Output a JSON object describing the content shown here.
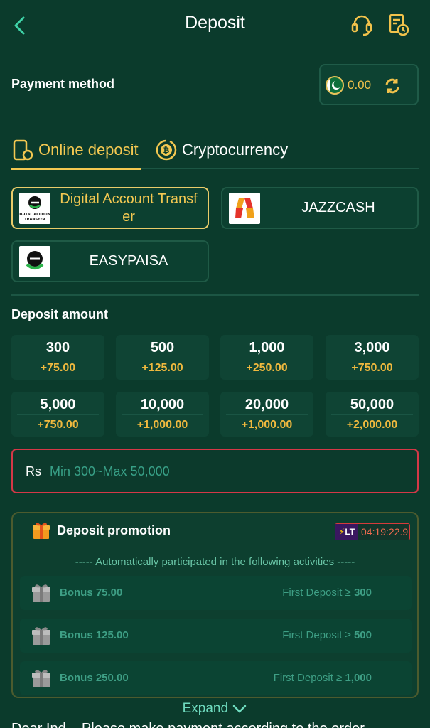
{
  "header": {
    "title": "Deposit",
    "back_icon": "chevron-left-icon",
    "support_icon": "headset-icon",
    "records_icon": "records-clock-icon"
  },
  "payment_method": {
    "label": "Payment method",
    "balance": "0.00",
    "currency_icon": "pakistan-flag-icon",
    "refresh_icon": "refresh-icon"
  },
  "tabs": [
    {
      "label": "Online deposit",
      "icon": "phone-icon",
      "active": true
    },
    {
      "label": "Cryptocurrency",
      "icon": "bitcoin-icon",
      "active": false
    }
  ],
  "methods": [
    {
      "label": "Digital Account Transf er",
      "logo_text": "DIGITAL ACCOUNT TRANSFER",
      "selected": true
    },
    {
      "label": "JAZZCASH",
      "selected": false
    },
    {
      "label": "EASYPAISA",
      "selected": false
    }
  ],
  "deposit_amount": {
    "label": "Deposit amount",
    "options": [
      {
        "amount": "300",
        "bonus": "+75.00"
      },
      {
        "amount": "500",
        "bonus": "+125.00"
      },
      {
        "amount": "1,000",
        "bonus": "+250.00"
      },
      {
        "amount": "3,000",
        "bonus": "+750.00"
      },
      {
        "amount": "5,000",
        "bonus": "+750.00"
      },
      {
        "amount": "10,000",
        "bonus": "+1,000.00"
      },
      {
        "amount": "20,000",
        "bonus": "+1,000.00"
      },
      {
        "amount": "50,000",
        "bonus": "+2,000.00"
      }
    ]
  },
  "amount_input": {
    "currency": "Rs",
    "value": "",
    "placeholder": "Min 300~Max 50,000"
  },
  "promotion": {
    "title": "Deposit promotion",
    "badge": "LT",
    "timer": "04:19:22.9",
    "subtitle": "----- Automatically participated in the following activities -----",
    "items": [
      {
        "bonus": "Bonus 75.00",
        "condition": "First Deposit ≥",
        "threshold": "300"
      },
      {
        "bonus": "Bonus 125.00",
        "condition": "First Deposit ≥",
        "threshold": "500"
      },
      {
        "bonus": "Bonus 250.00",
        "condition": "First Deposit ≥",
        "threshold": "1,000"
      }
    ],
    "expand_label": "Expand"
  },
  "footer_text": "Dear Ind... Please make payment according to the order"
}
